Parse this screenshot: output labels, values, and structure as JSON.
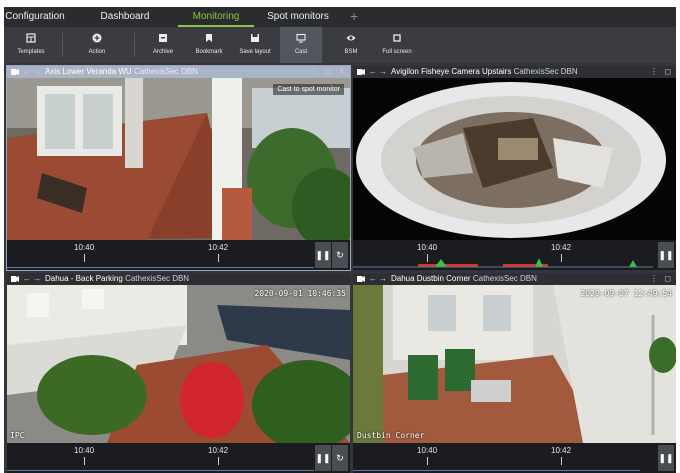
{
  "tabs": [
    {
      "label": "Configuration",
      "active": false
    },
    {
      "label": "Dashboard",
      "active": false
    },
    {
      "label": "Monitoring",
      "active": true
    },
    {
      "label": "Spot monitors",
      "active": false
    }
  ],
  "tab_add": "+",
  "toolbar": [
    {
      "label": "Templates",
      "icon": "templates-icon"
    },
    {
      "label": "Action",
      "icon": "action-icon"
    },
    {
      "label": "Archive",
      "icon": "archive-icon"
    },
    {
      "label": "Bookmark",
      "icon": "bookmark-icon"
    },
    {
      "label": "Save layout",
      "icon": "save-layout-icon"
    },
    {
      "label": "Cast",
      "icon": "cast-icon",
      "active": true
    },
    {
      "label": "BSM",
      "icon": "eye-icon"
    },
    {
      "label": "Full screen",
      "icon": "full-screen-icon"
    }
  ],
  "panes": [
    {
      "name": "Axis Lower Veranda WU",
      "site": "CathexisSec DBN",
      "selected": true,
      "tooltip": "Cast to spot monitor",
      "times": [
        "10:40",
        "10:42"
      ],
      "osd": ""
    },
    {
      "name": "Avigilon Fisheye Camera Upstairs",
      "site": "CathexisSec DBN",
      "selected": false,
      "tooltip": "",
      "times": [
        "10:40",
        "10:42"
      ],
      "osd": ""
    },
    {
      "name": "Dahua - Back Parking",
      "site": "CathexisSec DBN",
      "selected": false,
      "tooltip": "",
      "times": [
        "10:40",
        "10:42"
      ],
      "osd": "2020-09-01 10:46:35"
    },
    {
      "name": "Dahua Dustbin Corner",
      "site": "CathexisSec DBN",
      "selected": false,
      "tooltip": "",
      "times": [
        "10:40",
        "10:42"
      ],
      "osd": "2020-09-07 12:49:54"
    }
  ],
  "osd_corner": [
    "IPC",
    "Dustbin Corner"
  ],
  "colors": {
    "accent": "#8cc63f",
    "selected_header": "#a9b4c6",
    "event_red": "#d9342b",
    "event_green": "#3fbf3f"
  }
}
